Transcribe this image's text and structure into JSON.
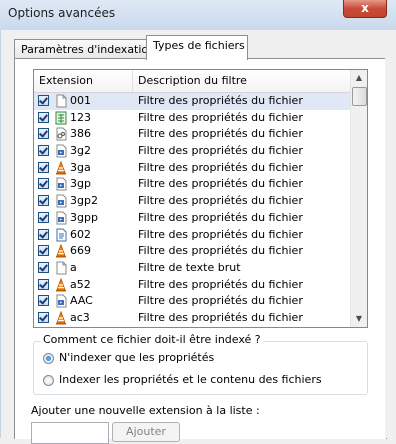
{
  "window": {
    "title": "Options avancées",
    "close_glyph": "x"
  },
  "tabs": [
    {
      "label": "Paramètres d'indexation",
      "active": false
    },
    {
      "label": "Types de fichiers",
      "active": true
    }
  ],
  "list": {
    "columns": {
      "extension": "Extension",
      "description": "Description du filtre"
    },
    "rows": [
      {
        "ext": "001",
        "desc": "Filtre des propriétés du fichier",
        "icon": "blank-file-icon",
        "checked": true,
        "selected": true
      },
      {
        "ext": "123",
        "desc": "Filtre des propriétés du fichier",
        "icon": "spreadsheet-file-icon",
        "checked": true
      },
      {
        "ext": "386",
        "desc": "Filtre des propriétés du fichier",
        "icon": "system-file-icon",
        "checked": true
      },
      {
        "ext": "3g2",
        "desc": "Filtre des propriétés du fichier",
        "icon": "media-file-icon",
        "checked": true
      },
      {
        "ext": "3ga",
        "desc": "Filtre des propriétés du fichier",
        "icon": "vlc-cone-icon",
        "checked": true
      },
      {
        "ext": "3gp",
        "desc": "Filtre des propriétés du fichier",
        "icon": "media-file-icon",
        "checked": true
      },
      {
        "ext": "3gp2",
        "desc": "Filtre des propriétés du fichier",
        "icon": "media-file-icon",
        "checked": true
      },
      {
        "ext": "3gpp",
        "desc": "Filtre des propriétés du fichier",
        "icon": "media-file-icon",
        "checked": true
      },
      {
        "ext": "602",
        "desc": "Filtre des propriétés du fichier",
        "icon": "document-file-icon",
        "checked": true
      },
      {
        "ext": "669",
        "desc": "Filtre des propriétés du fichier",
        "icon": "vlc-cone-icon",
        "checked": true
      },
      {
        "ext": "a",
        "desc": "Filtre de texte brut",
        "icon": "blank-file-icon",
        "checked": true
      },
      {
        "ext": "a52",
        "desc": "Filtre des propriétés du fichier",
        "icon": "vlc-cone-icon",
        "checked": true
      },
      {
        "ext": "AAC",
        "desc": "Filtre des propriétés du fichier",
        "icon": "media-file-icon",
        "checked": true
      },
      {
        "ext": "ac3",
        "desc": "Filtre des propriétés du fichier",
        "icon": "vlc-cone-icon",
        "checked": true
      }
    ]
  },
  "index_options": {
    "legend": "Comment ce fichier doit-il être indexé ?",
    "option1": "N'indexer que les propriétés",
    "option2": "Indexer les propriétés et le contenu des fichiers",
    "selected": 1
  },
  "add_extension": {
    "label": "Ajouter une nouvelle extension à la liste :",
    "input_value": "",
    "button_label": "Ajouter"
  },
  "colors": {
    "titlebar": "#c9d9ee",
    "close_button": "#c74a36",
    "selection": "#dfe8f4"
  }
}
